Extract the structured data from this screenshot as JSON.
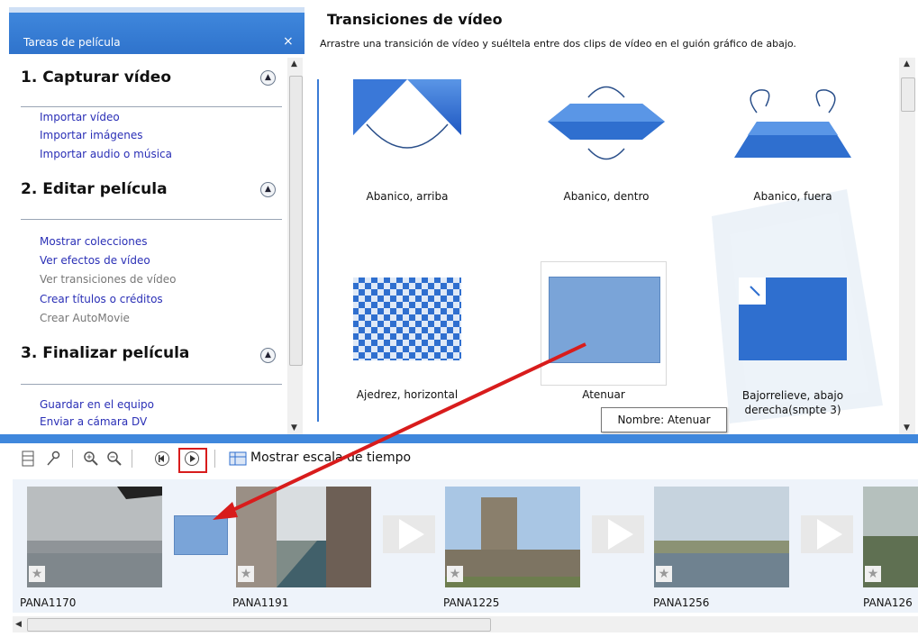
{
  "task_pane": {
    "title": "Tareas de película",
    "close_glyph": "×",
    "sections": [
      {
        "title": "1. Capturar vídeo",
        "tasks": [
          {
            "label": "Importar vídeo",
            "enabled": true
          },
          {
            "label": "Importar imágenes",
            "enabled": true
          },
          {
            "label": "Importar audio o música",
            "enabled": true
          }
        ]
      },
      {
        "title": "2. Editar película",
        "tasks": [
          {
            "label": "Mostrar colecciones",
            "enabled": true
          },
          {
            "label": "Ver efectos de vídeo",
            "enabled": true
          },
          {
            "label": "Ver transiciones de vídeo",
            "enabled": false
          },
          {
            "label": "Crear títulos o créditos",
            "enabled": true
          },
          {
            "label": "Crear AutoMovie",
            "enabled": false
          }
        ]
      },
      {
        "title": "3. Finalizar película",
        "tasks": [
          {
            "label": "Guardar en el equipo",
            "enabled": true
          },
          {
            "label": "Enviar a cámara DV",
            "enabled": true
          }
        ]
      }
    ]
  },
  "transitions_panel": {
    "title": "Transiciones de vídeo",
    "subtitle": "Arrastre una transición de vídeo y suéltela entre dos clips de vídeo en el guión gráfico de abajo.",
    "items": [
      {
        "label": "Abanico, arriba"
      },
      {
        "label": "Abanico, dentro"
      },
      {
        "label": "Abanico, fuera"
      },
      {
        "label": "Ajedrez, horizontal"
      },
      {
        "label": "Atenuar",
        "selected": true
      },
      {
        "label": "Bajorrelieve, abajo derecha(smpte 3)"
      }
    ],
    "tooltip": "Nombre: Atenuar"
  },
  "toolbar": {
    "timeline_label": "Mostrar escala de tiempo",
    "icons": [
      "storyboard-icon",
      "audio-levels-icon",
      "zoom-in-icon",
      "zoom-out-icon",
      "rewind-icon",
      "play-icon",
      "timeline-icon"
    ]
  },
  "storyboard": {
    "clips": [
      {
        "name": "PANA1170"
      },
      {
        "name": "PANA1191"
      },
      {
        "name": "PANA1225"
      },
      {
        "name": "PANA1256"
      },
      {
        "name": "PANA126"
      }
    ]
  },
  "colors": {
    "accent_blue": "#3f87dc",
    "link_blue": "#2a2fb6",
    "highlight_red": "#d81c1c",
    "transition_blue": "#2f6fcf"
  }
}
